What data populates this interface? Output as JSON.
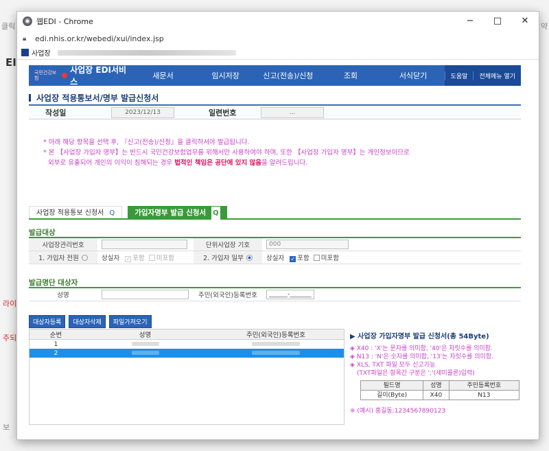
{
  "background": {
    "left_edge": "클릭",
    "left_side_1": "EI",
    "left_side_2": "라이",
    "left_side_3": "주되",
    "left_side_4": "보",
    "right_edge": "약"
  },
  "browser": {
    "title": "웹EDI - Chrome",
    "url": "edi.nhis.or.kr/webedi/xui/index.jsp",
    "tab_title": "사업장",
    "min": "−",
    "max": "□",
    "close": "✕"
  },
  "nav": {
    "logo_mark": "국민건강보험",
    "logo_text": "사업장 EDI서비스",
    "items": [
      "새문서",
      "임시저장",
      "신고(전송)/신청",
      "조회",
      "서식닫기"
    ],
    "help": "도움말",
    "menu_open": "전체메뉴 열기"
  },
  "page_title": "사업장 적용통보서/명부 발급신청서",
  "info": {
    "date_label": "작성일",
    "date_value": "2023/12/13",
    "serial_label": "일련번호",
    "serial_value": "..."
  },
  "notes": {
    "line1": "* 아래 해당 항목을 선택 후, 『신고(전송)/신청』을 클릭하셔야 발급됩니다.",
    "line2": "* 본 【사업장 가입자 명부】는 반드시 국민건강보험업무를 위해서만 사용하여야 하며, 또한 【사업장 가입자 명부】는 개인정보이므로",
    "line3_a": "외부로 유출되어 개인의 이익이 침해되는 경우 ",
    "line3_b": "법적인 책임은 공단에 있지 않음",
    "line3_c": "을 알려드립니다."
  },
  "tabs": {
    "tab1": "사업장 적용통보 신청서",
    "tab2": "가입자명부 발급 신청서",
    "search_icon": "Q"
  },
  "target": {
    "section": "발급대상",
    "mgmt_no_label": "사업장관리번호",
    "unit_label": "단위사업장 기호",
    "unit_value": "000",
    "all_label": "1. 가입자 전원",
    "partial_label": "2. 가입자 일부",
    "lost_label": "상실자",
    "include": "포함",
    "exclude": "미포함"
  },
  "person": {
    "section": "발급명단 대상자",
    "name_label": "성명",
    "rrn_label": "주민(외국인)등록번호",
    "rrn_value": "______-_______"
  },
  "buttons": [
    "대상자등록",
    "대상자삭제",
    "파일가져오기"
  ],
  "grid": {
    "headers": [
      "순번",
      "성명",
      "주민(외국인)등록번호"
    ],
    "rows": [
      {
        "no": "1"
      },
      {
        "no": "2"
      }
    ]
  },
  "format": {
    "title": "▶ 사업장 가입자명부 발급 신청서(총 54Byte)",
    "line1": "◈ X40 : 'X'는 문자를 의미함, '40'은 자릿수를 의미함.",
    "line2": "◈ N13 : 'N'은 숫자를 의미함, '13'는 자릿수를 의미함.",
    "line3": "◈ XLS, TXT 파일 모두 신고가능",
    "line4": "(TXT파일은 항목간 구분은 ';'(세미콜론)입력)",
    "table_headers": [
      "필드명",
      "성명",
      "주민등록번호"
    ],
    "table_row": [
      "길이(Byte)",
      "X40",
      "N13"
    ],
    "example": "※ (예시) 홍길동;1234567890123"
  },
  "colors": {
    "nav": "#2b64b7",
    "green": "#3a9a3a",
    "pink": "#c83ec8",
    "selected": "#1e8fe6"
  }
}
